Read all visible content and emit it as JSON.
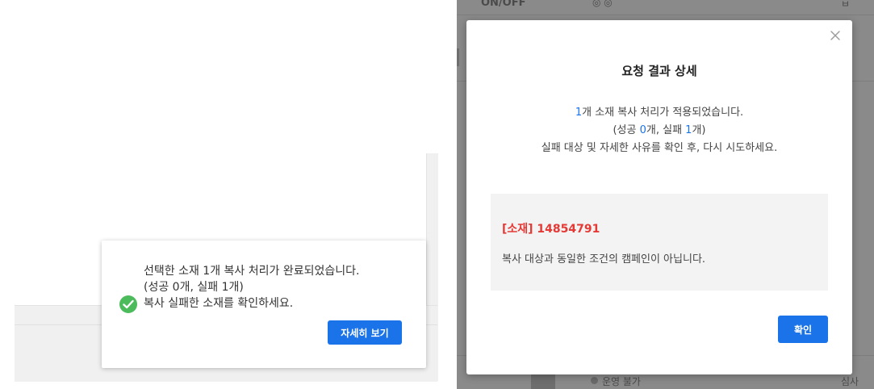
{
  "toast": {
    "line1": "선택한 소재 1개 복사 처리가 완료되었습니다.",
    "line2": "(성공 0개, 실패 1개)",
    "line3": "복사 실패한 소재를 확인하세요.",
    "detail_button": "자세히 보기",
    "icon": "check-circle-icon"
  },
  "modal": {
    "title": "요청 결과 상세",
    "body": {
      "l1_count": "1",
      "l1_text": "개 소재 복사 처리가 적용되었습니다.",
      "l2_pre": "(성공 ",
      "l2_success": "0",
      "l2_mid": "개, 실패 ",
      "l2_fail": "1",
      "l2_post": "개)",
      "l3": "실패 대상 및 자세한 사유를 확인 후, 다시 시도하세요."
    },
    "failure": {
      "title": "[소재] 14854791",
      "message": "복사 대상과 동일한 조건의 캠페인이 아닙니다."
    },
    "confirm_button": "확인",
    "close_icon": "close-icon"
  },
  "background": {
    "top_left": "ON/OFF",
    "bottom_text": "운영 불가"
  },
  "colors": {
    "primary": "#1a73e8",
    "success": "#4cbb5c",
    "error": "#e53935",
    "overlay": "#8a8a8a"
  }
}
